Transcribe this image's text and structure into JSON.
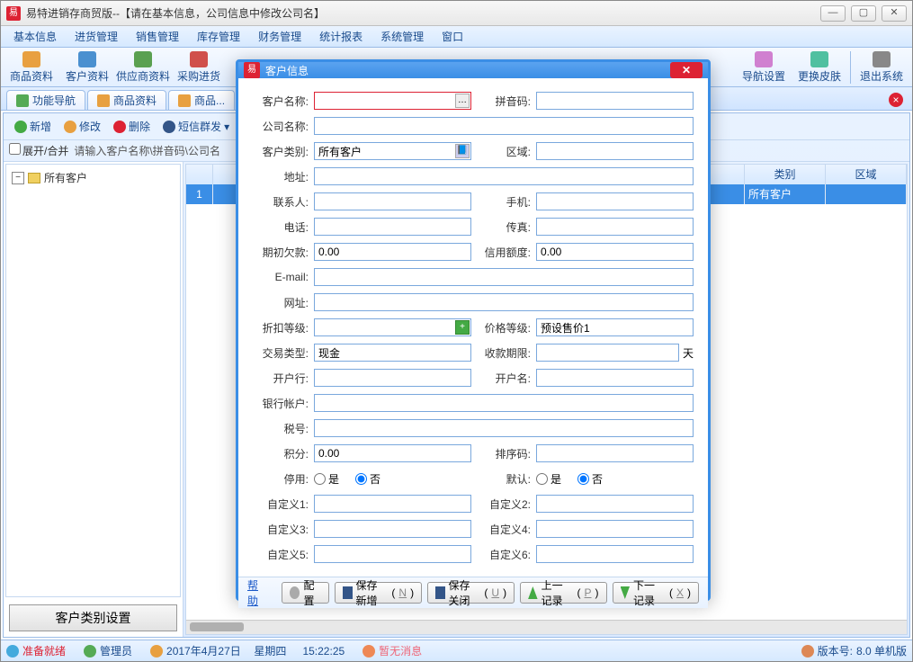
{
  "window": {
    "title": "易特进销存商贸版--【请在基本信息，公司信息中修改公司名】"
  },
  "menu": [
    "基本信息",
    "进货管理",
    "销售管理",
    "库存管理",
    "财务管理",
    "统计报表",
    "系统管理",
    "窗口"
  ],
  "toolbar": {
    "items": [
      "商品资料",
      "客户资料",
      "供应商资料",
      "采购进货"
    ],
    "right": [
      "导航设置",
      "更换皮肤",
      "退出系统"
    ]
  },
  "tabs": [
    "功能导航",
    "商品资料",
    "商品..."
  ],
  "actions": {
    "add": "新增",
    "edit": "修改",
    "del": "删除",
    "sms": "短信群发"
  },
  "filter": {
    "expand": "展开/合并",
    "hint": "请输入客户名称\\拼音码\\公司名"
  },
  "tree": {
    "root": "所有客户"
  },
  "grid": {
    "cols": [
      "",
      "类别",
      "区域"
    ],
    "row1": {
      "num": "1",
      "cat": "所有客户",
      "region": ""
    }
  },
  "sidebar": {
    "btn": "客户类别设置"
  },
  "status": {
    "ready": "准备就绪",
    "user": "管理员",
    "date": "2017年4月27日",
    "weekday": "星期四",
    "time": "15:22:25",
    "msg": "暂无消息",
    "ver_label": "版本号:",
    "ver": "8.0 单机版"
  },
  "dialog": {
    "title": "客户信息",
    "labels": {
      "name": "客户名称",
      "pinyin": "拼音码",
      "company": "公司名称",
      "cat": "客户类别",
      "region": "区域",
      "addr": "地址",
      "contact": "联系人",
      "mobile": "手机",
      "tel": "电话",
      "fax": "传真",
      "debt": "期初欠款",
      "credit": "信用额度",
      "email": "E-mail",
      "url": "网址",
      "discount": "折扣等级",
      "price": "价格等级",
      "tradetype": "交易类型",
      "payperiod": "收款期限",
      "bank": "开户行",
      "acctname": "开户名",
      "acctno": "银行帐户",
      "taxid": "税号",
      "points": "积分",
      "sortcode": "排序码",
      "disabled": "停用",
      "default": "默认",
      "c1": "自定义1",
      "c2": "自定义2",
      "c3": "自定义3",
      "c4": "自定义4",
      "c5": "自定义5",
      "c6": "自定义6"
    },
    "values": {
      "cat": "所有客户",
      "debt": "0.00",
      "credit": "0.00",
      "price": "预设售价1",
      "tradetype": "现金",
      "points": "0.00",
      "day_unit": "天",
      "yes": "是",
      "no": "否",
      "disabled": "no",
      "default": "no"
    },
    "footer": {
      "help": "帮助",
      "config": "配置",
      "savenew": "保存新增",
      "saveclose": "保存关闭",
      "prev": "上一记录",
      "next": "下一记录",
      "k_savenew": "N",
      "k_saveclose": "U",
      "k_prev": "P",
      "k_next": "X"
    }
  }
}
